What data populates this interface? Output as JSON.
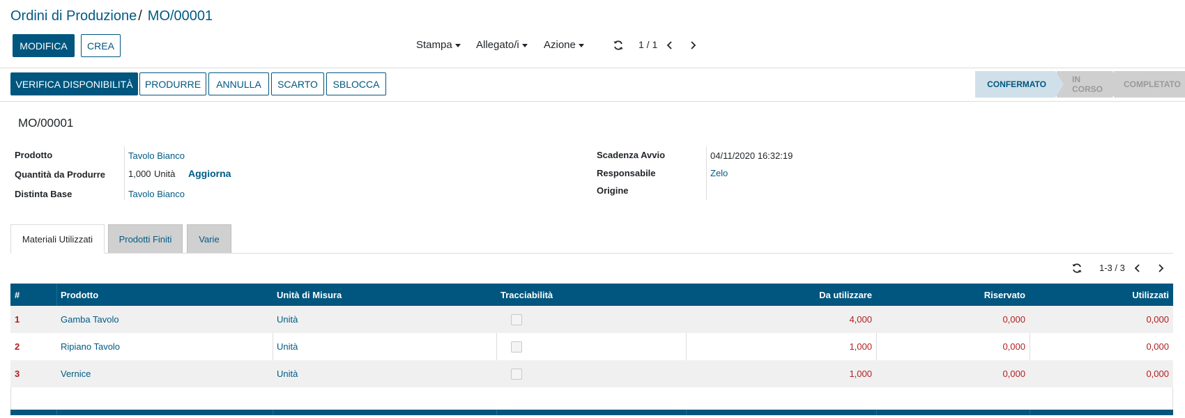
{
  "breadcrumb": {
    "parent": "Ordini di Produzione",
    "separator": "/",
    "current": "MO/00001"
  },
  "control_panel": {
    "edit_label": "MODIFICA",
    "create_label": "CREA",
    "print_label": "Stampa",
    "attachments_label": "Allegato/i",
    "action_label": "Azione",
    "pager": "1 / 1"
  },
  "header_buttons": {
    "check_availability": "VERIFICA DISPONIBILITÀ",
    "produce": "PRODURRE",
    "cancel": "ANNULLA",
    "scrap": "SCARTO",
    "unlock": "SBLOCCA"
  },
  "status_stages": [
    "CONFERMATO",
    "IN CORSO",
    "COMPLETATO"
  ],
  "record": {
    "name": "MO/00001",
    "fields": {
      "product_label": "Prodotto",
      "product_value": "Tavolo Bianco",
      "qty_label": "Quantità da Produrre",
      "qty_value": "1,000",
      "qty_uom": "Unità",
      "update_label": "Aggiorna",
      "bom_label": "Distinta Base",
      "bom_value": "Tavolo Bianco",
      "start_label": "Scadenza Avvio",
      "start_value": "04/11/2020 16:32:19",
      "responsible_label": "Responsabile",
      "responsible_value": "Zelo",
      "origin_label": "Origine",
      "origin_value": ""
    }
  },
  "tabs": [
    {
      "label": "Materiali Utilizzati",
      "active": true
    },
    {
      "label": "Prodotti Finiti",
      "active": false
    },
    {
      "label": "Varie",
      "active": false
    }
  ],
  "list_pager": "1-3 / 3",
  "table": {
    "headers": [
      "#",
      "Prodotto",
      "Unità di Misura",
      "Tracciabilità",
      "Da utilizzare",
      "Riservato",
      "Utilizzati"
    ],
    "rows": [
      {
        "num": "1",
        "product": "Gamba Tavolo",
        "uom": "Unità",
        "to_consume": "4,000",
        "reserved": "0,000",
        "consumed": "0,000"
      },
      {
        "num": "2",
        "product": "Ripiano Tavolo",
        "uom": "Unità",
        "to_consume": "1,000",
        "reserved": "0,000",
        "consumed": "0,000"
      },
      {
        "num": "3",
        "product": "Vernice",
        "uom": "Unità",
        "to_consume": "1,000",
        "reserved": "0,000",
        "consumed": "0,000"
      }
    ]
  },
  "colors": {
    "primary": "#00567e",
    "link": "#005a84",
    "negative_red": "#b21d1d"
  }
}
